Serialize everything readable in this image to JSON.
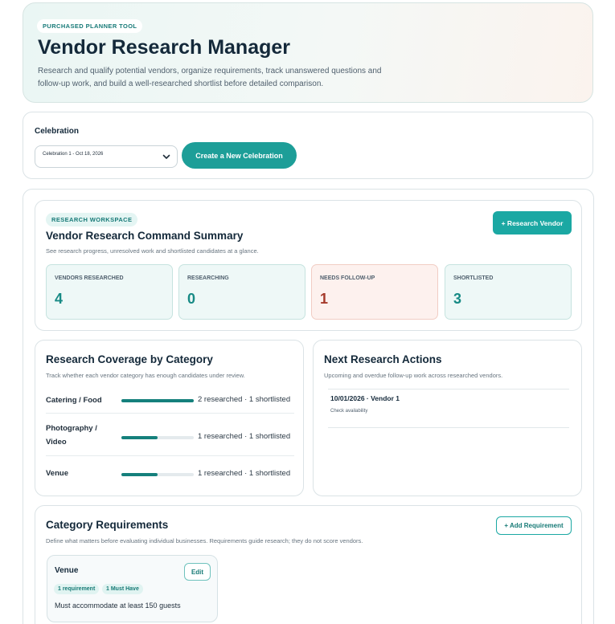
{
  "hero": {
    "badge": "PURCHASED PLANNER TOOL",
    "title": "Vendor Research Manager",
    "description": "Research and qualify potential vendors, organize requirements, track unanswered questions and follow-up work, and build a well-researched shortlist before detailed comparison."
  },
  "celebration": {
    "label": "Celebration",
    "selected": "Celebration 1 - Oct 18, 2026",
    "create_button": "Create a New Celebration"
  },
  "summary": {
    "badge": "RESEARCH WORKSPACE",
    "title": "Vendor Research Command Summary",
    "subtitle": "See research progress, unresolved work and shortlisted candidates at a glance.",
    "research_button": "+ Research Vendor",
    "stats": [
      {
        "label": "VENDORS RESEARCHED",
        "value": "4"
      },
      {
        "label": "RESEARCHING",
        "value": "0"
      },
      {
        "label": "NEEDS FOLLOW-UP",
        "value": "1"
      },
      {
        "label": "SHORTLISTED",
        "value": "3"
      }
    ]
  },
  "coverage": {
    "title": "Research Coverage by Category",
    "subtitle": "Track whether each vendor category has enough candidates under review.",
    "rows": [
      {
        "name": "Catering / Food",
        "stats": "2 researched · 1 shortlisted",
        "fill": 1.0
      },
      {
        "name": "Photography / Video",
        "stats": "1 researched · 1 shortlisted",
        "fill": 0.5
      },
      {
        "name": "Venue",
        "stats": "1 researched · 1 shortlisted",
        "fill": 0.5
      }
    ]
  },
  "actions": {
    "title": "Next Research Actions",
    "subtitle": "Upcoming and overdue follow-up work across researched vendors.",
    "items": [
      {
        "heading": "10/01/2026 · Vendor 1",
        "note": "Check availability"
      }
    ]
  },
  "requirements": {
    "title": "Category Requirements",
    "subtitle": "Define what matters before evaluating individual businesses. Requirements guide research; they do not score vendors.",
    "add_button": "+ Add Requirement",
    "cards": [
      {
        "category": "Venue",
        "edit_label": "Edit",
        "count_tag": "1 requirement",
        "must_tag": "1 Must Have",
        "text": "Must accommodate at least 150 guests"
      }
    ]
  },
  "colors": {
    "accent": "#1d9e98",
    "warn": "#a53a2b"
  }
}
